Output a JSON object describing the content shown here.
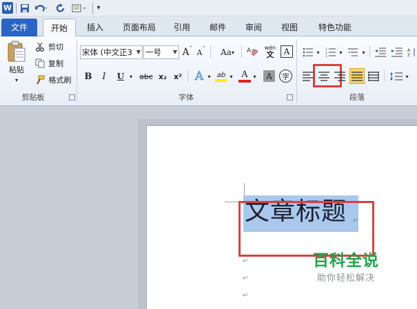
{
  "qat": {
    "logo": "W",
    "icons": [
      "save-icon",
      "undo-icon",
      "redo-icon",
      "print-preview-icon",
      "customize-qat-icon"
    ]
  },
  "tabs": [
    {
      "label": "文件"
    },
    {
      "label": "开始"
    },
    {
      "label": "插入"
    },
    {
      "label": "页面布局"
    },
    {
      "label": "引用"
    },
    {
      "label": "邮件"
    },
    {
      "label": "审阅"
    },
    {
      "label": "视图"
    },
    {
      "label": "特色功能"
    }
  ],
  "clipboard": {
    "paste": "粘贴",
    "cut": "剪切",
    "copy": "复制",
    "format_painter": "格式刷",
    "group": "剪贴板"
  },
  "font": {
    "name": "宋体 (中文正3",
    "size": "一号",
    "grow": "A",
    "shrink": "A",
    "change_case": "Aa",
    "phonetic": "wén",
    "border_char": "A",
    "bold": "B",
    "italic": "I",
    "underline": "U",
    "strike": "abc",
    "subscript": "x₂",
    "superscript": "x²",
    "text_effect": "A",
    "highlight": "ab",
    "font_color": "A",
    "char_shading": "A",
    "enclose_char": "字",
    "group": "字体"
  },
  "paragraph": {
    "group": "段落",
    "align_selected": "center"
  },
  "document": {
    "title": "文章标题",
    "para_mark": "↵"
  },
  "watermark": {
    "title": "百科全说",
    "subtitle": "助你轻松解决"
  },
  "colors": {
    "highlight_box": "#d9403f",
    "selection": "#a9c8ec",
    "file_tab": "#2a64c4",
    "watermark_green": "#23a34c"
  }
}
